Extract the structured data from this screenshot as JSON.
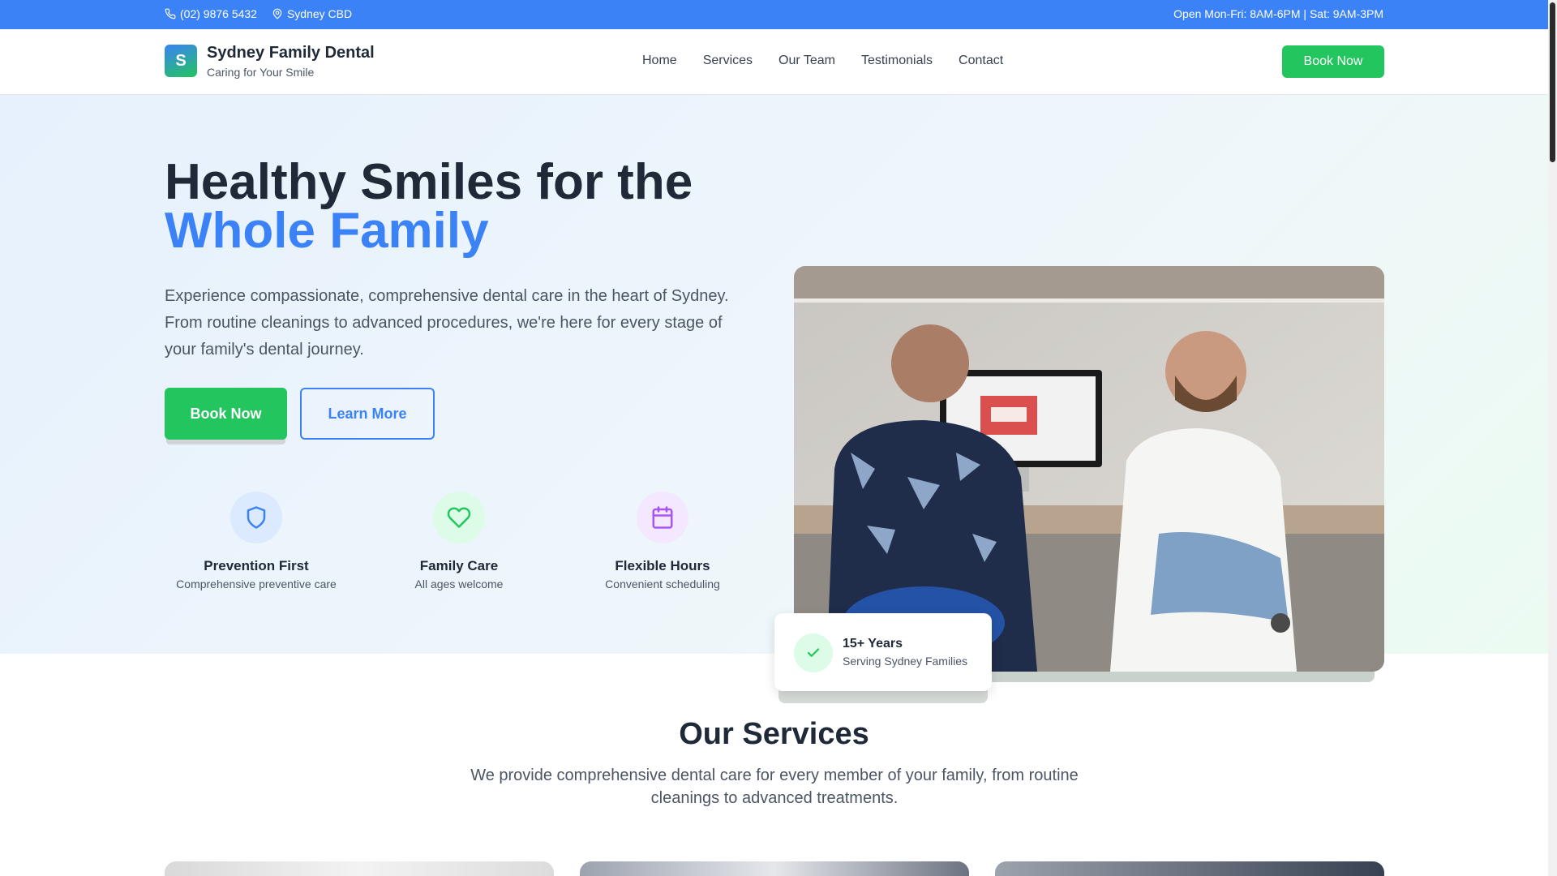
{
  "topbar": {
    "phone": "(02) 9876 5432",
    "location": "Sydney CBD",
    "hours": "Open Mon-Fri: 8AM-6PM | Sat: 9AM-3PM"
  },
  "header": {
    "logo_letter": "S",
    "brand_name": "Sydney Family Dental",
    "tagline": "Caring for Your Smile",
    "nav": [
      "Home",
      "Services",
      "Our Team",
      "Testimonials",
      "Contact"
    ],
    "cta": "Book Now"
  },
  "hero": {
    "title_line1": "Healthy Smiles for the",
    "title_line2": "Whole Family",
    "description": "Experience compassionate, comprehensive dental care in the heart of Sydney. From routine cleanings to advanced procedures, we're here for every stage of your family's dental journey.",
    "primary_button": "Book Now",
    "secondary_button": "Learn More",
    "features": [
      {
        "icon": "shield-icon",
        "title": "Prevention First",
        "desc": "Comprehensive preventive care"
      },
      {
        "icon": "heart-icon",
        "title": "Family Care",
        "desc": "All ages welcome"
      },
      {
        "icon": "calendar-icon",
        "title": "Flexible Hours",
        "desc": "Convenient scheduling"
      }
    ],
    "badge": {
      "icon": "check-icon",
      "title": "15+ Years",
      "subtitle": "Serving Sydney Families"
    }
  },
  "services": {
    "title": "Our Services",
    "description": "We provide comprehensive dental care for every member of your family, from routine cleanings to advanced treatments."
  },
  "colors": {
    "primary_blue": "#3b82f6",
    "primary_green": "#22c55e",
    "text_dark": "#1f2937",
    "text_muted": "#4b5563"
  }
}
